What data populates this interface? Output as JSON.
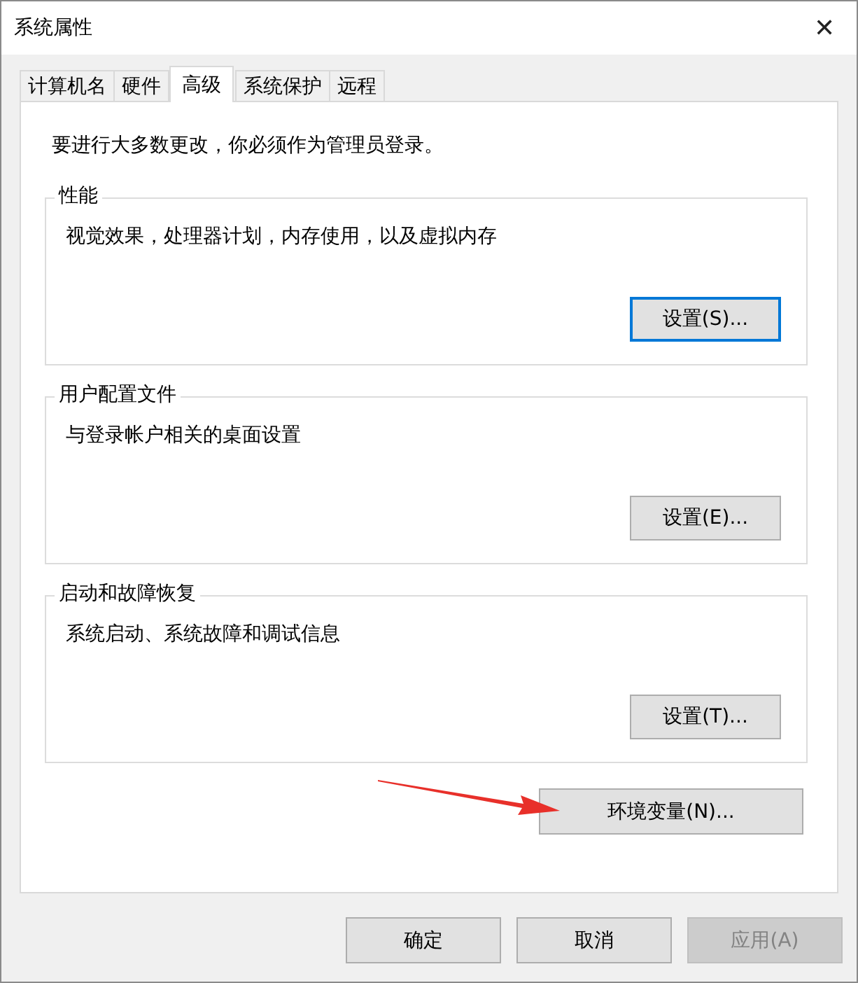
{
  "window": {
    "title": "系统属性",
    "close": "✕"
  },
  "tabs": [
    {
      "label": "计算机名",
      "selected": false
    },
    {
      "label": "硬件",
      "selected": false
    },
    {
      "label": "高级",
      "selected": true
    },
    {
      "label": "系统保护",
      "selected": false
    },
    {
      "label": "远程",
      "selected": false
    }
  ],
  "notice": "要进行大多数更改，你必须作为管理员登录。",
  "groups": [
    {
      "title": "性能",
      "description": "视觉效果，处理器计划，内存使用，以及虚拟内存",
      "button": {
        "label": "设置(S)...",
        "focused": true
      }
    },
    {
      "title": "用户配置文件",
      "description": "与登录帐户相关的桌面设置",
      "button": {
        "label": "设置(E)...",
        "focused": false
      }
    },
    {
      "title": "启动和故障恢复",
      "description": "系统启动、系统故障和调试信息",
      "button": {
        "label": "设置(T)...",
        "focused": false
      }
    }
  ],
  "environment_button": {
    "label": "环境变量(N)...",
    "focused": false
  },
  "footer_buttons": [
    {
      "label": "确定",
      "disabled": false
    },
    {
      "label": "取消",
      "disabled": false
    },
    {
      "label": "应用(A)",
      "disabled": true
    }
  ]
}
